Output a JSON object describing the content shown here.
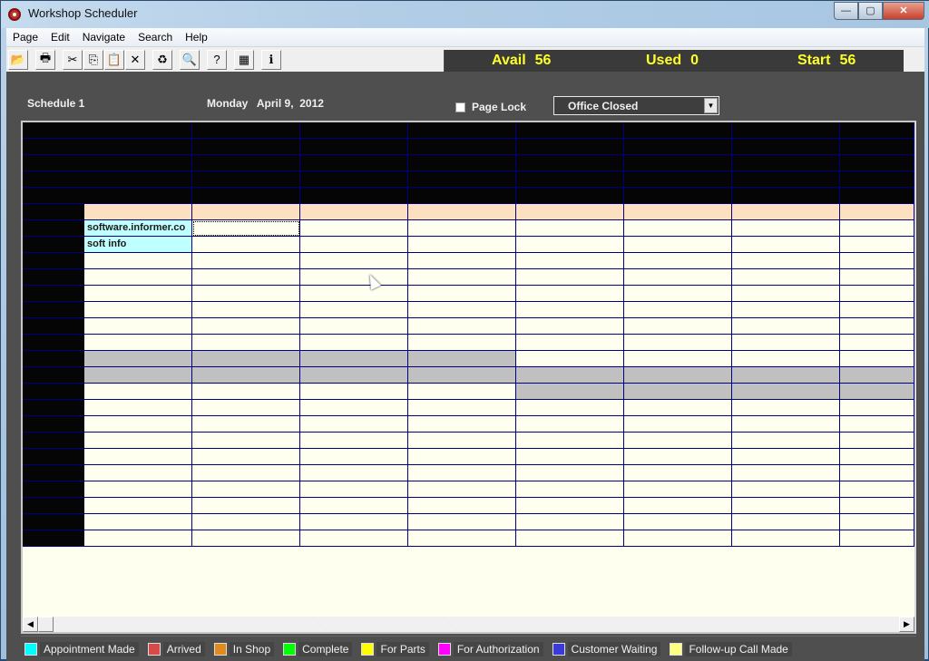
{
  "window": {
    "title": "Workshop Scheduler",
    "controls": {
      "minimize": "—",
      "maximize": "▢",
      "close": "✕"
    }
  },
  "menu": [
    "Page",
    "Edit",
    "Navigate",
    "Search",
    "Help"
  ],
  "toolbar": {
    "buttons": [
      {
        "name": "open-icon",
        "glyph": "📂"
      },
      {
        "name": "print-icon",
        "glyph": "🖶"
      },
      {
        "name": "cut-icon",
        "glyph": "✂"
      },
      {
        "name": "copy-icon",
        "glyph": "⎘"
      },
      {
        "name": "paste-icon",
        "glyph": "📋"
      },
      {
        "name": "delete-icon",
        "glyph": "✕"
      },
      {
        "name": "refresh-icon",
        "glyph": "♻"
      },
      {
        "name": "find-icon",
        "glyph": "🔍"
      },
      {
        "name": "help-icon",
        "glyph": "?"
      },
      {
        "name": "calendar-icon",
        "glyph": "▦"
      },
      {
        "name": "info-icon",
        "glyph": "ℹ"
      }
    ]
  },
  "stats": {
    "avail_label": "Avail",
    "avail_value": "56",
    "used_label": "Used",
    "used_value": "0",
    "start_label": "Start",
    "start_value": "56",
    "color": "#ffff2a"
  },
  "schedule": {
    "name": "Schedule 1",
    "date": "Monday   April 9,  2012",
    "page_lock_label": "Page Lock",
    "page_lock_checked": false,
    "status_select": "Office Closed"
  },
  "grid": {
    "columns": 9,
    "rows": 26,
    "header_rows": 5,
    "entries": [
      {
        "row": 6,
        "col": 1,
        "text": "software.informer.co",
        "color": "cyan"
      },
      {
        "row": 7,
        "col": 1,
        "text": "soft info",
        "color": "cyan"
      }
    ],
    "focused_cell": {
      "row": 6,
      "col": 2
    },
    "blocked": [
      {
        "row": 14,
        "cols": [
          1,
          2,
          3,
          4
        ]
      },
      {
        "row": 15,
        "cols": [
          1,
          2,
          3,
          4,
          5,
          6,
          7,
          8
        ]
      },
      {
        "row": 16,
        "cols": [
          5,
          6,
          7,
          8
        ]
      }
    ]
  },
  "legend": [
    {
      "label": "Appointment Made",
      "color": "#00ffff"
    },
    {
      "label": "Arrived",
      "color": "#d84a4a"
    },
    {
      "label": "In Shop",
      "color": "#e08a20"
    },
    {
      "label": "Complete",
      "color": "#00ff00"
    },
    {
      "label": "For Parts",
      "color": "#ffff00"
    },
    {
      "label": "For Authorization",
      "color": "#ff00ff"
    },
    {
      "label": "Customer Waiting",
      "color": "#3a3ad8"
    },
    {
      "label": "Follow-up Call Made",
      "color": "#ffff80"
    }
  ],
  "scrollbar": {
    "left_arrow": "◀",
    "right_arrow": "▶"
  }
}
